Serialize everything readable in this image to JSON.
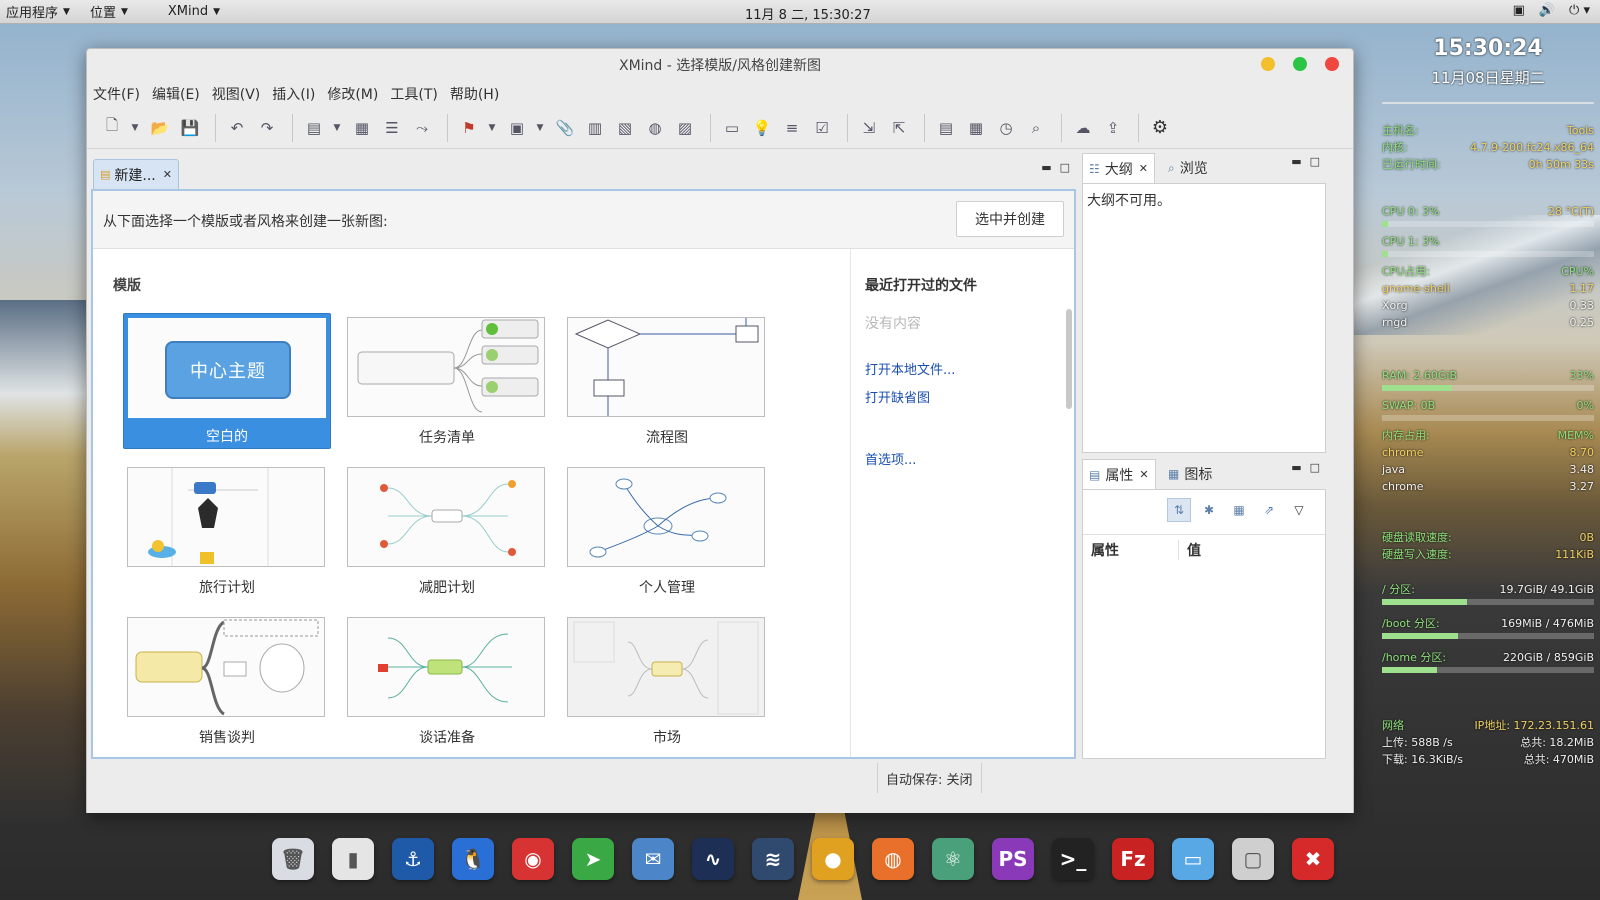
{
  "topbar": {
    "menus": [
      "应用程序",
      "位置",
      "XMind"
    ],
    "clock": "11月  8 二, 15:30:27"
  },
  "window": {
    "title": "XMind - 选择模版/风格创建新图",
    "menu": [
      "文件(F)",
      "编辑(E)",
      "视图(V)",
      "插入(I)",
      "修改(M)",
      "工具(T)",
      "帮助(H)"
    ]
  },
  "editor": {
    "tab_label": "新建...",
    "instruction": "从下面选择一个模版或者风格来创建一张新图:",
    "create_button": "选中并创建",
    "templates_title": "模版",
    "central_topic": "中心主题",
    "templates": [
      {
        "label": "空白的",
        "selected": true
      },
      {
        "label": "任务清单",
        "selected": false
      },
      {
        "label": "流程图",
        "selected": false
      },
      {
        "label": "旅行计划",
        "selected": false
      },
      {
        "label": "减肥计划",
        "selected": false
      },
      {
        "label": "个人管理",
        "selected": false
      },
      {
        "label": "销售谈判",
        "selected": false
      },
      {
        "label": "谈话准备",
        "selected": false
      },
      {
        "label": "市场",
        "selected": false
      }
    ],
    "recent": {
      "title": "最近打开过的文件",
      "empty": "没有内容",
      "open_local": "打开本地文件...",
      "open_default": "打开缺省图",
      "preferences": "首选项..."
    }
  },
  "outline_panel": {
    "tab_outline": "大纲",
    "tab_overview": "浏览",
    "message": "大纲不可用。"
  },
  "properties_panel": {
    "tab_properties": "属性",
    "tab_icons": "图标",
    "col_property": "属性",
    "col_value": "值"
  },
  "status": {
    "autosave": "自动保存: 关闭"
  },
  "conky": {
    "time": "15:30:24",
    "date": "11月08日星期二",
    "rows1": [
      {
        "k": "主机名:",
        "v": "Tools"
      },
      {
        "k": "内核:",
        "v": "4.7.9-200.fc24.x86_64"
      },
      {
        "k": "已运行时间:",
        "v": "0h 50m 33s"
      }
    ],
    "cpu0": {
      "k": "CPU 0: 3%",
      "v": "28 °C(T)",
      "level": 0.03
    },
    "cpu1": {
      "k": "CPU 1: 3%",
      "v": "",
      "level": 0.03
    },
    "cpu_head": {
      "k": "CPU占用:",
      "v": "CPU%"
    },
    "cpu_procs": [
      {
        "k": "gnome-shell",
        "v": "1.17"
      },
      {
        "k": "Xorg",
        "v": "0.33"
      },
      {
        "k": "rngd",
        "v": "0.25"
      }
    ],
    "ram": {
      "k": "RAM: 2.60GiB",
      "v": "33%",
      "level": 0.33
    },
    "swap": {
      "k": "SWAP: 0B",
      "v": "0%",
      "level": 0.0
    },
    "mem_head": {
      "k": "内存占用:",
      "v": "MEM%"
    },
    "mem_procs": [
      {
        "k": "chrome",
        "v": "8.70"
      },
      {
        "k": "java",
        "v": "3.48"
      },
      {
        "k": "chrome",
        "v": "3.27"
      }
    ],
    "disk_read": {
      "k": "硬盘读取速度:",
      "v": "0B"
    },
    "disk_write": {
      "k": "硬盘写入速度:",
      "v": "111KiB"
    },
    "root": {
      "k": "/ 分区:",
      "v": "19.7GiB/ 49.1GiB",
      "level": 0.4
    },
    "boot": {
      "k": "/boot 分区:",
      "v": "169MiB / 476MiB",
      "level": 0.36
    },
    "home": {
      "k": "/home 分区:",
      "v": "220GiB / 859GiB",
      "level": 0.26
    },
    "net_head": {
      "k": "网络",
      "v": "IP地址: 172.23.151.61"
    },
    "upload": {
      "k": "上传: 588B  /s",
      "v": "总共: 18.2MiB"
    },
    "download": {
      "k": "下载: 16.3KiB/s",
      "v": "总共: 470MiB"
    }
  },
  "dock": [
    {
      "name": "trash-icon",
      "glyph": "🗑",
      "color": "#d9dde3"
    },
    {
      "name": "switch-icon",
      "glyph": "▮",
      "color": "#e5e5e5"
    },
    {
      "name": "install-icon",
      "glyph": "⚓",
      "color": "#1e5aa8"
    },
    {
      "name": "qq-icon",
      "glyph": "🐧",
      "color": "#2a6fd6"
    },
    {
      "name": "netease-music-icon",
      "glyph": "◉",
      "color": "#d83333"
    },
    {
      "name": "telegram-icon",
      "glyph": "➤",
      "color": "#3aa844"
    },
    {
      "name": "mail-icon",
      "glyph": "✉",
      "color": "#4d86c8"
    },
    {
      "name": "system-monitor-icon",
      "glyph": "∿",
      "color": "#1d2f55"
    },
    {
      "name": "wireshark-icon",
      "glyph": "≋",
      "color": "#2f4a6e"
    },
    {
      "name": "chrome-icon",
      "glyph": "●",
      "color": "#e0a020"
    },
    {
      "name": "firefox-icon",
      "glyph": "◍",
      "color": "#e8702a"
    },
    {
      "name": "atom-icon",
      "glyph": "⚛",
      "color": "#4aa07a"
    },
    {
      "name": "phpstorm-icon",
      "glyph": "PS",
      "color": "#8a3ab8"
    },
    {
      "name": "terminal-icon",
      "glyph": ">_",
      "color": "#222"
    },
    {
      "name": "filezilla-icon",
      "glyph": "Fz",
      "color": "#c82222"
    },
    {
      "name": "files-icon",
      "glyph": "▭",
      "color": "#58a8e6"
    },
    {
      "name": "window-icon",
      "glyph": "▢",
      "color": "#cfcfcf"
    },
    {
      "name": "xmind-icon",
      "glyph": "✖",
      "color": "#d62a2a"
    }
  ]
}
